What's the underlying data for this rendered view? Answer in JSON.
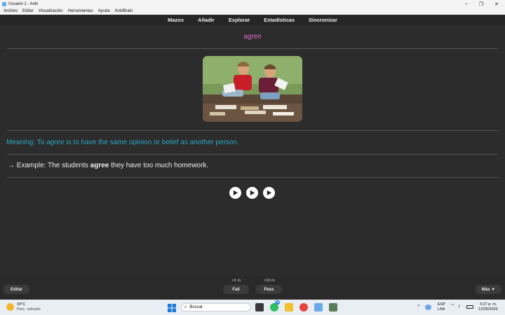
{
  "window": {
    "title": "Usuario 1 - Anki"
  },
  "menu": [
    "Archivo",
    "Editar",
    "Visualización",
    "Herramientas",
    "Ayuda",
    "AnkiBrain"
  ],
  "topnav": [
    "Mazos",
    "Añadir",
    "Explorar",
    "Estadísticas",
    "Sincronizar"
  ],
  "card": {
    "word": "agree",
    "meaning_prefix": "Meaning: To ",
    "meaning_em": "agree",
    "meaning_suffix": " is to have the same opinion or belief as another person.",
    "example_prefix": "→ Example: The students ",
    "example_bold": "agree",
    "example_suffix": " they have too much homework."
  },
  "bottom": {
    "edit_label": "Editar",
    "fail_time": "<1 m",
    "fail_label": "Fail",
    "pass_time": "<10 m",
    "pass_label": "Pass",
    "more_label": "Más ▼"
  },
  "taskbar": {
    "weather_temp": "34°C",
    "weather_desc": "Parc. soleado",
    "search_placeholder": "Buscar",
    "whatsapp_badge": "66",
    "lang_top": "ESP",
    "lang_bottom": "LAA",
    "time": "4:27 p. m.",
    "date": "12/05/2026"
  },
  "colors": {
    "word": "#e466c8",
    "meaning": "#2ea6c4",
    "background": "#2c2c2c"
  }
}
